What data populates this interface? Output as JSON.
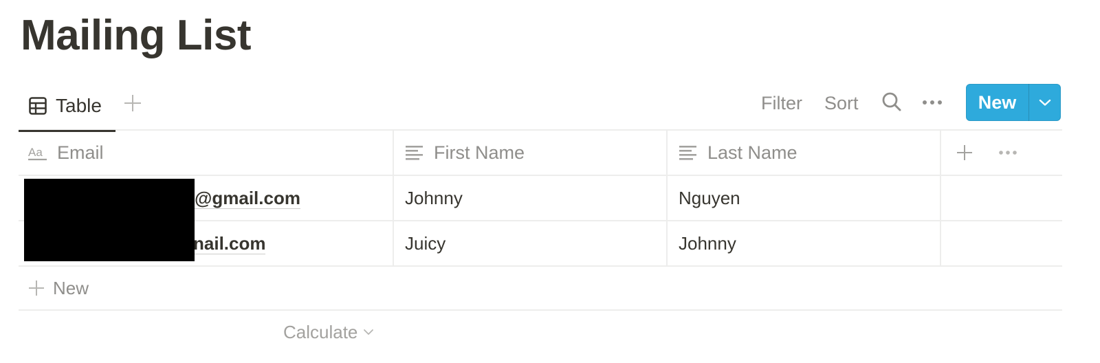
{
  "page": {
    "title": "Mailing List"
  },
  "viewbar": {
    "tabs": [
      {
        "label": "Table",
        "icon": "table-icon",
        "active": true
      }
    ],
    "add_view_icon": "plus-icon",
    "filter_label": "Filter",
    "sort_label": "Sort",
    "search_icon": "search-icon",
    "more_icon": "more-horizontal-icon",
    "new_button_label": "New",
    "new_dropdown_icon": "chevron-down-icon"
  },
  "colors": {
    "accent": "#2eaadc",
    "text": "#37352f",
    "muted": "#8f8e8b",
    "border": "#ededec"
  },
  "table": {
    "columns": [
      {
        "label": "Email",
        "icon": "title-property-icon"
      },
      {
        "label": "First Name",
        "icon": "text-property-icon"
      },
      {
        "label": "Last Name",
        "icon": "text-property-icon"
      }
    ],
    "add_column_icon": "plus-icon",
    "column_more_icon": "more-horizontal-icon",
    "rows": [
      {
        "email_visible": "@gmail.com",
        "first_name": "Johnny",
        "last_name": "Nguyen"
      },
      {
        "email_visible": "nail.com",
        "first_name": "Juicy",
        "last_name": "Johnny"
      }
    ],
    "new_row_label": "New",
    "calculate_label": "Calculate"
  }
}
